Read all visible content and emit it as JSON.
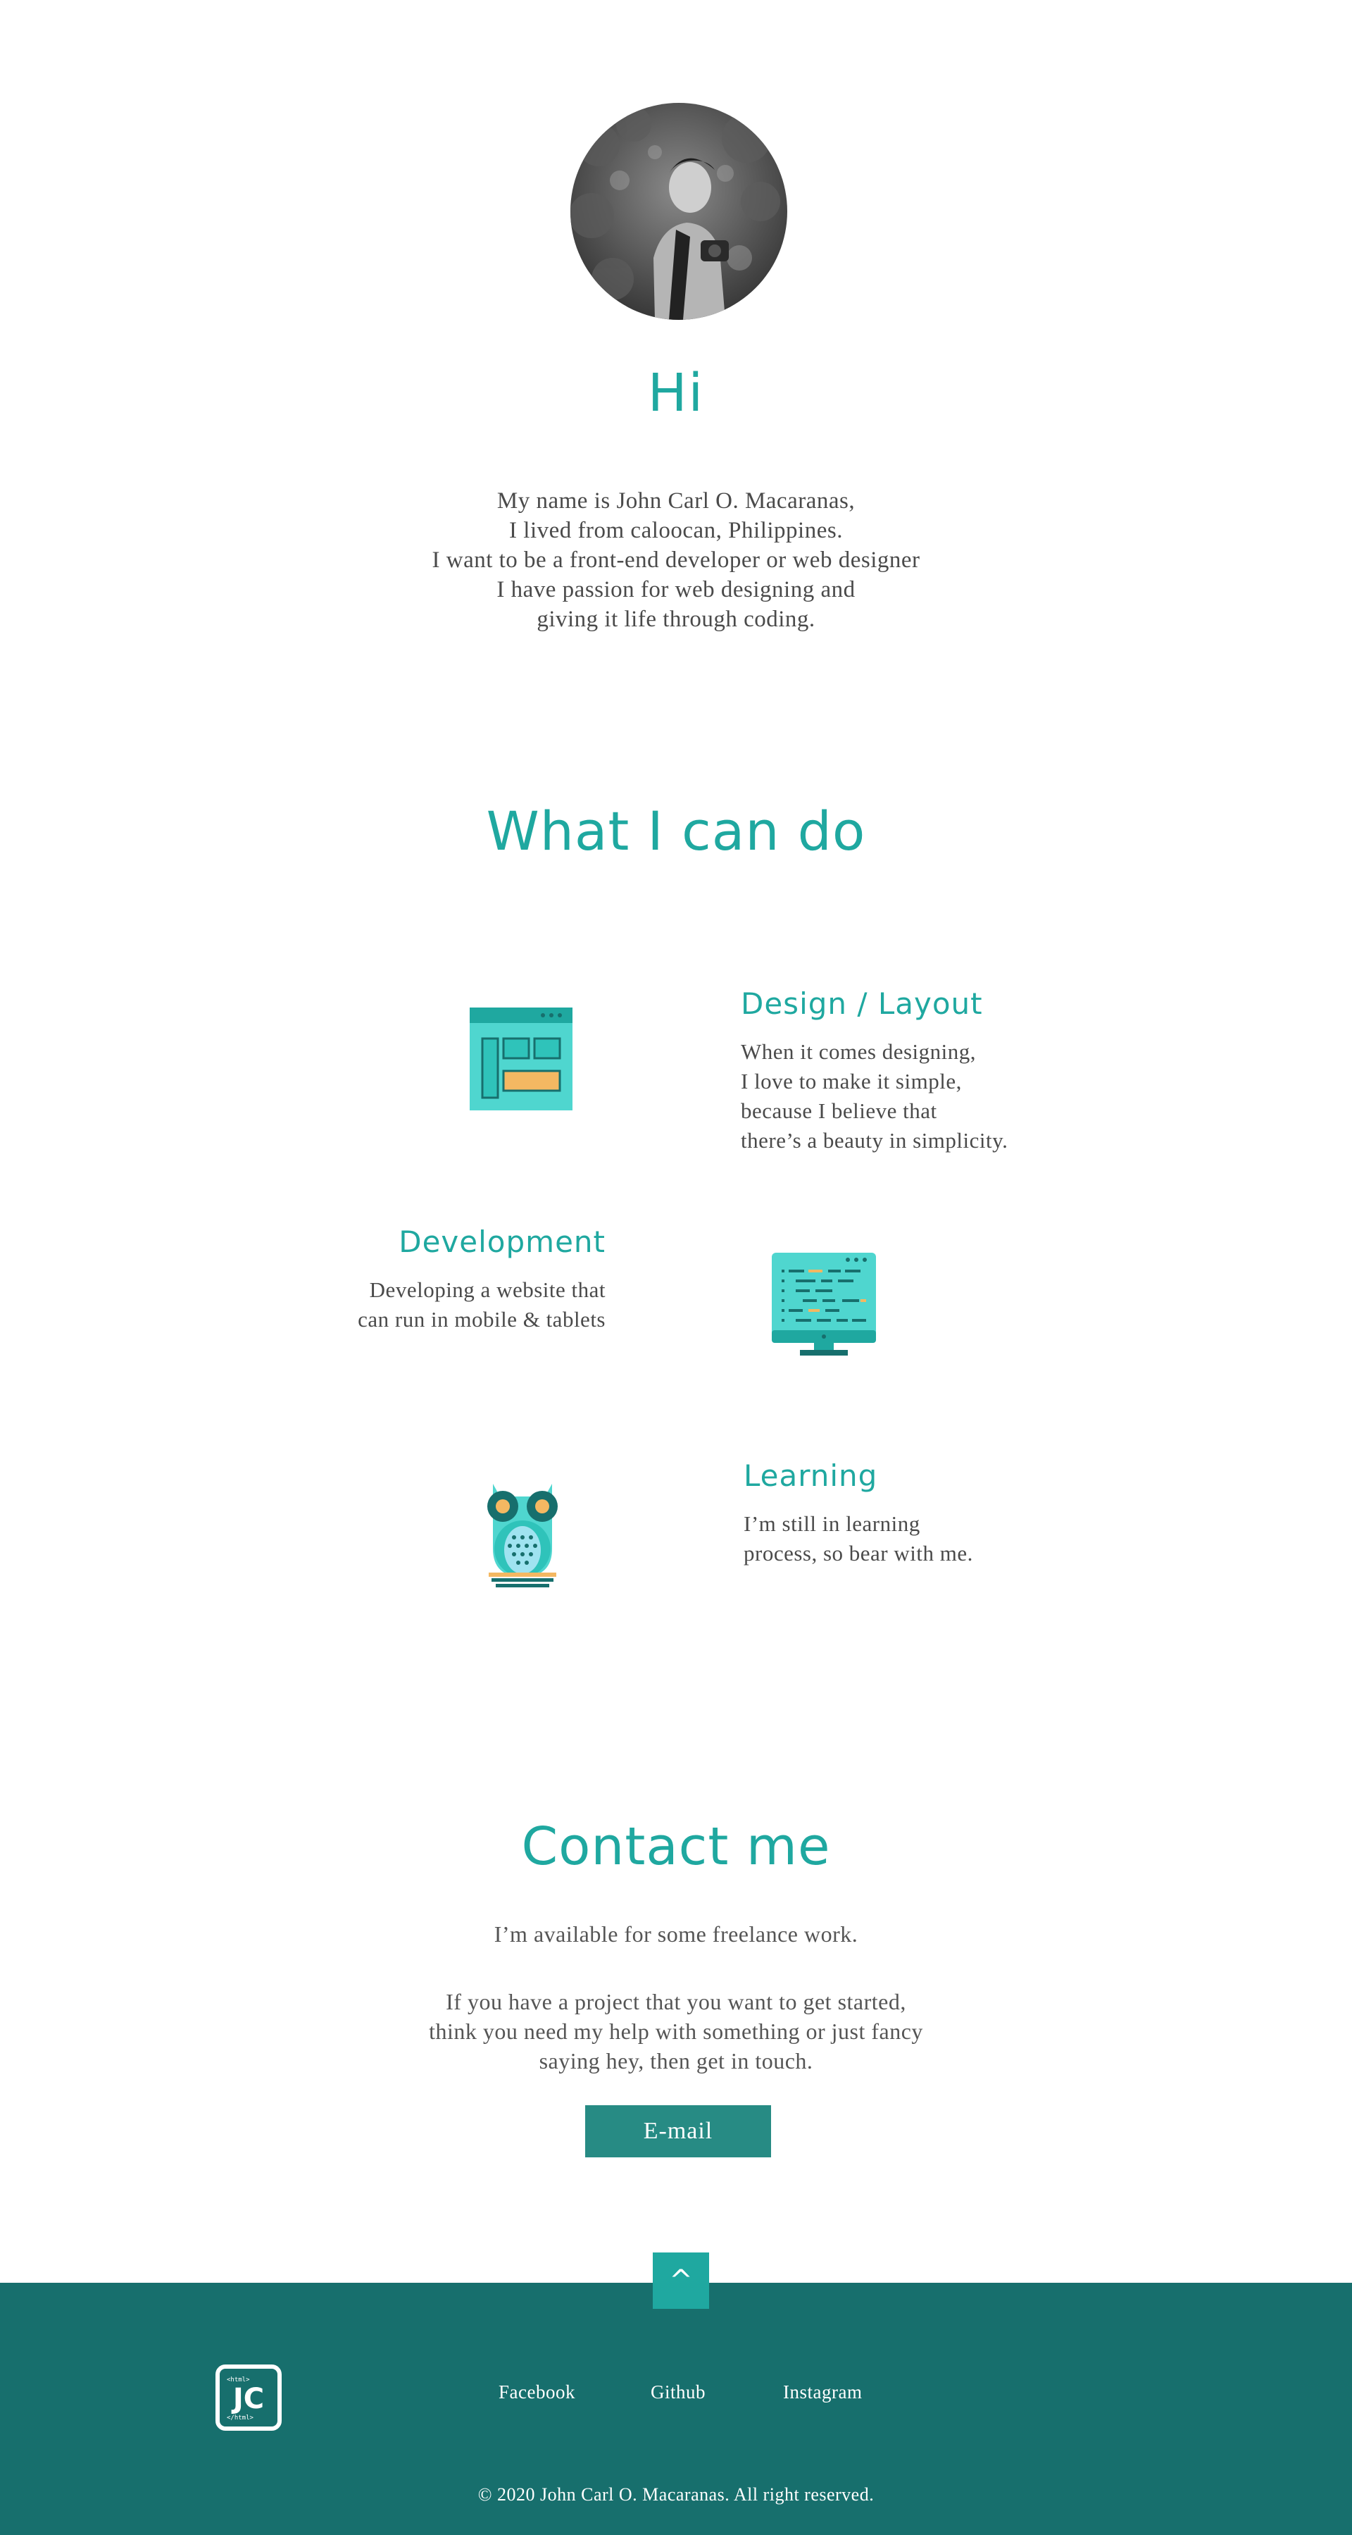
{
  "hero": {
    "greeting": "Hi",
    "intro_lines": [
      "My name is  John Carl O. Macaranas,",
      "I lived from caloocan, Philippines.",
      "I want to be a front-end developer or web designer",
      "I have passion for web designing and",
      "giving it life through coding."
    ]
  },
  "skills": {
    "title": "What I can do",
    "items": [
      {
        "title": "Design / Layout",
        "lines": [
          "When it comes designing,",
          "I love to make it simple,",
          "because I believe that",
          "there’s a beauty in simplicity."
        ],
        "icon": "layout-icon"
      },
      {
        "title": "Development",
        "lines": [
          "Developing a website that",
          "can run in mobile & tablets"
        ],
        "icon": "monitor-code-icon"
      },
      {
        "title": "Learning",
        "lines": [
          "I’m still in learning",
          "process, so bear with me."
        ],
        "icon": "owl-icon"
      }
    ]
  },
  "contact": {
    "title": "Contact me",
    "availability": "I’m available for some freelance work.",
    "message_lines": [
      "If  you have a project that you want to get started,",
      "think you need my help with something or just fancy",
      "saying hey, then get in touch."
    ],
    "email_label": "E-mail"
  },
  "footer": {
    "back_to_top": "^",
    "links": [
      "Facebook",
      "Github",
      "Instagram"
    ],
    "copyright": "© 2020 John Carl O. Macaranas. All right reserved."
  },
  "colors": {
    "accent": "#1fa8a0",
    "button": "#278b84",
    "footer": "#176f6d"
  }
}
